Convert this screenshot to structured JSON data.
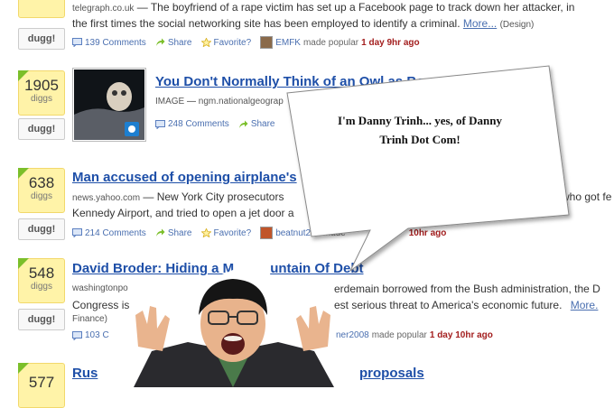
{
  "stories": [
    {
      "diggs": "",
      "diggs_label": "diggs",
      "dugg_label": "dugg!",
      "source": "telegraph.co.uk",
      "dash": " — ",
      "desc": "The boyfriend of a rape victim has set up a Facebook page to track down her attacker, in",
      "desc2": "the first times the social networking site has been employed to identify a criminal.",
      "more": "More...",
      "tag": "(Design)",
      "comments": "139 Comments",
      "share": "Share",
      "favorite": "Favorite?",
      "user": "EMFK",
      "made_popular": "made popular",
      "ago": "1 day 9hr ago"
    },
    {
      "diggs": "1905",
      "diggs_label": "diggs",
      "dugg_label": "dugg!",
      "title": "You Don't Normally Think of an Owl as Be",
      "image_label": "IMAGE",
      "source": "ngm.nationalgeograp",
      "comments": "248 Comments",
      "share": "Share"
    },
    {
      "diggs": "638",
      "diggs_label": "diggs",
      "dugg_label": "dugg!",
      "title": "Man accused of opening airplane's",
      "source": "news.yahoo.com",
      "desc": "New York City prosecutors",
      "desc_right": "who got fe",
      "desc2": "Kennedy Airport, and tried to open a jet door a",
      "comments": "214 Comments",
      "share": "Share",
      "favorite": "Favorite?",
      "user": "beatnut2k4",
      "made_popular": "made",
      "ago": "10hr ago"
    },
    {
      "diggs": "548",
      "diggs_label": "diggs",
      "dugg_label": "dugg!",
      "title_a": "David Broder: Hiding a M",
      "title_b": "untain Of Debt",
      "source": "washingtonpo",
      "desc_right": "erdemain borrowed from the Bush administration, the D",
      "desc2_left": "Congress is",
      "desc2_right": "est serious threat to America's economic future.",
      "more": "More.",
      "desc3": "Finance)",
      "comments": "103 C",
      "user_tail": "ner2008",
      "made_popular": "made popular",
      "ago": "1 day 10hr ago"
    },
    {
      "diggs": "577",
      "title_a": "Rus",
      "title_b": "proposals"
    }
  ],
  "bubble": {
    "line1": "I'm Danny Trinh... yes, of Danny",
    "line2": "Trinh Dot Com!"
  },
  "colors": {
    "link": "#1e4fa8",
    "diggs_bg": "#fff3a8",
    "popular_time": "#a31e1e"
  }
}
